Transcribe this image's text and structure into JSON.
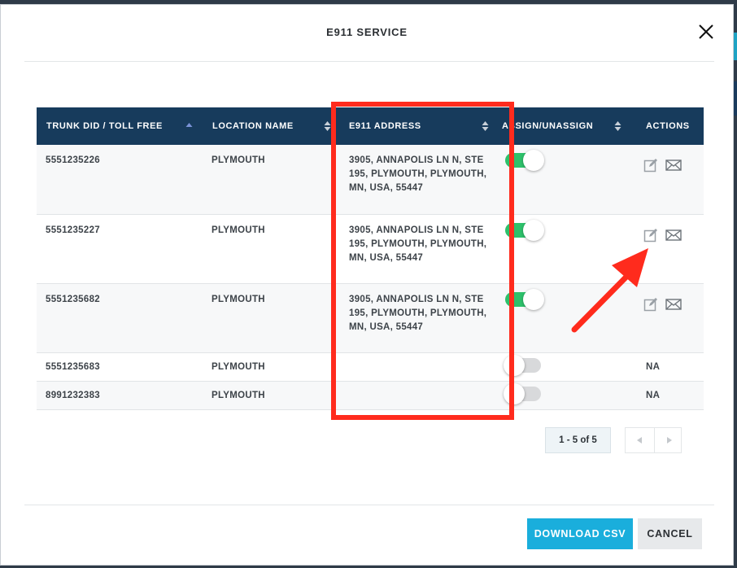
{
  "modal": {
    "title": "E911 SERVICE"
  },
  "table": {
    "columns": [
      {
        "label": "TRUNK DID / TOLL FREE",
        "sort": "asc"
      },
      {
        "label": "LOCATION NAME",
        "sort": "none"
      },
      {
        "label": "E911 ADDRESS",
        "sort": "both"
      },
      {
        "label": "ASSIGN/UNASSIGN",
        "sort": "both"
      },
      {
        "label": "ACTIONS",
        "sort": "none"
      }
    ],
    "rows": [
      {
        "trunk": "5551235226",
        "location": "PLYMOUTH",
        "address": "3905, ANNAPOLIS LN N, STE 195, PLYMOUTH, PLYMOUTH, MN, USA, 55447",
        "assigned": true,
        "actions": "icons"
      },
      {
        "trunk": "5551235227",
        "location": "PLYMOUTH",
        "address": "3905, ANNAPOLIS LN N, STE 195, PLYMOUTH, PLYMOUTH, MN, USA, 55447",
        "assigned": true,
        "actions": "icons"
      },
      {
        "trunk": "5551235682",
        "location": "PLYMOUTH",
        "address": "3905, ANNAPOLIS LN N, STE 195, PLYMOUTH, PLYMOUTH, MN, USA, 55447",
        "assigned": true,
        "actions": "icons"
      },
      {
        "trunk": "5551235683",
        "location": "PLYMOUTH",
        "address": "",
        "assigned": false,
        "actions": "NA"
      },
      {
        "trunk": "8991232383",
        "location": "PLYMOUTH",
        "address": "",
        "assigned": false,
        "actions": "NA"
      }
    ]
  },
  "pagination": {
    "label": "1 - 5 of 5"
  },
  "footer": {
    "download_label": "DOWNLOAD CSV",
    "cancel_label": "CANCEL"
  },
  "icons": {
    "edit": "edit-icon",
    "email": "email-icon",
    "close": "close-icon"
  },
  "colors": {
    "header_bg": "#173b5c",
    "toggle_on": "#2ec16b",
    "toggle_off": "#d8d9db",
    "primary_button": "#1aaedc",
    "annotation_red": "#ff2b1d"
  }
}
